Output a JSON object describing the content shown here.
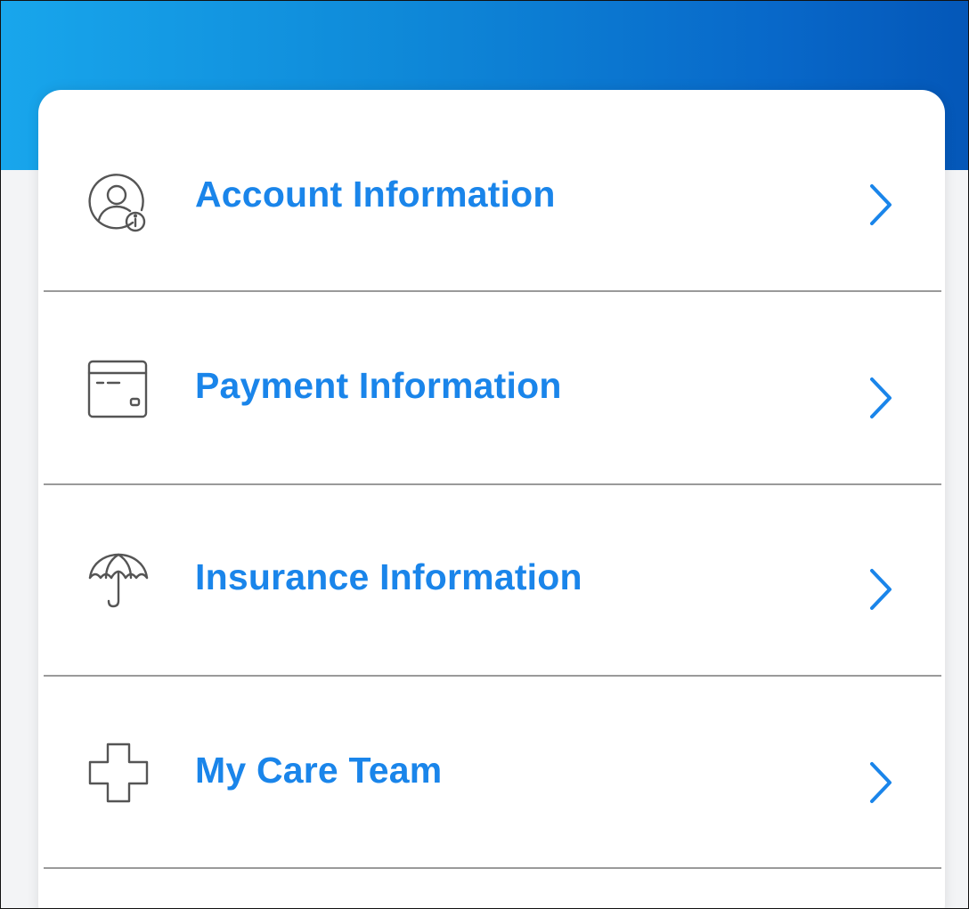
{
  "colors": {
    "accent": "#1a85ea",
    "header_gradient_start": "#18a6ec",
    "header_gradient_end": "#0457b8",
    "icon_stroke": "#555555",
    "divider": "#9a9a9a"
  },
  "menu": {
    "items": [
      {
        "label": "Account Information",
        "icon": "account-info-icon"
      },
      {
        "label": "Payment Information",
        "icon": "credit-card-icon"
      },
      {
        "label": "Insurance Information",
        "icon": "umbrella-icon"
      },
      {
        "label": "My Care Team",
        "icon": "medical-cross-icon"
      }
    ]
  }
}
